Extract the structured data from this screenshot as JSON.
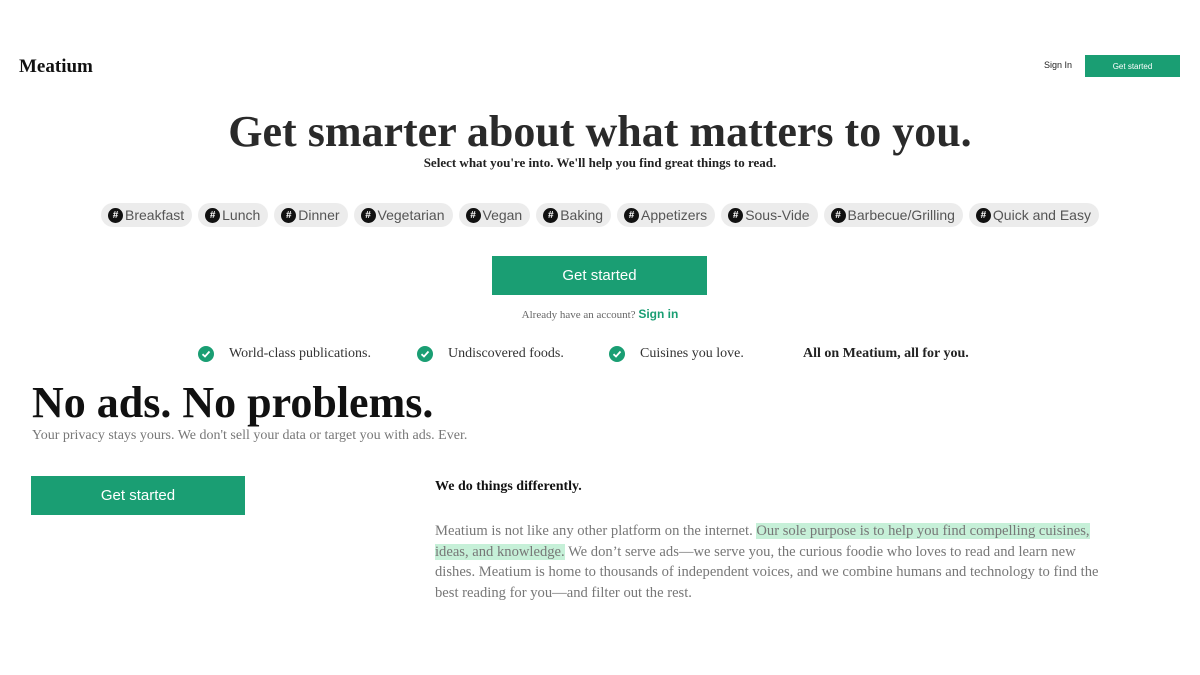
{
  "header": {
    "logo": "Meatium",
    "signin_label": "Sign In",
    "get_started_label": "Get started"
  },
  "hero": {
    "title": "Get smarter about what matters to you.",
    "subtitle": "Select what you're into. We'll help you find great things to read.",
    "tags": [
      "Breakfast",
      "Lunch",
      "Dinner",
      "Vegetarian",
      "Vegan",
      "Baking",
      "Appetizers",
      "Sous-Vide",
      "Barbecue/Grilling",
      "Quick and Easy"
    ],
    "tag_prefix": "#",
    "button_label": "Get started",
    "already_text": "Already have an account?",
    "signin_link": "Sign in"
  },
  "features": {
    "items": [
      "World-class publications.",
      "Undiscovered foods.",
      "Cuisines you love."
    ],
    "tagline": "All on Meatium, all for you."
  },
  "privacy": {
    "title": "No ads. No problems.",
    "subtitle": "Your privacy stays yours. We don't sell your data or target you with ads. Ever.",
    "button_label": "Get started"
  },
  "different": {
    "heading": "We do things differently.",
    "body_start": "Meatium is not like any other platform on the internet. ",
    "body_highlight": "Our sole purpose is to help you find compelling cuisines, ideas, and knowledge.",
    "body_end": " We don’t serve ads—we serve you, the curious foodie who loves to read and learn new dishes. Meatium is home to thousands of independent voices, and we combine humans and technology to find the best reading for you—and filter out the rest."
  },
  "colors": {
    "accent": "#1a9e73",
    "highlight": "#c6f0d8"
  },
  "icons": {
    "check": "check-circle-icon",
    "hash": "hashtag-icon"
  }
}
